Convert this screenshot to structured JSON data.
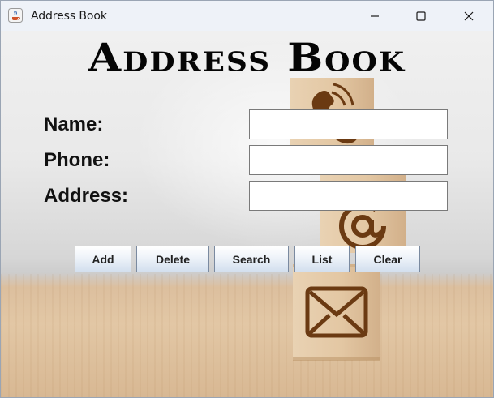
{
  "window": {
    "title": "Address Book"
  },
  "heading": "Address Book",
  "form": {
    "name_label": "Name:",
    "phone_label": "Phone:",
    "address_label": "Address:",
    "name_value": "",
    "phone_value": "",
    "address_value": ""
  },
  "buttons": {
    "add": "Add",
    "delete": "Delete",
    "search": "Search",
    "list": "List",
    "clear": "Clear"
  },
  "colors": {
    "wood": "#e3c8a6",
    "icon_brown": "#6b3a12",
    "button_border": "#7a8aa0"
  },
  "icons": [
    "java-app-icon",
    "minimize-icon",
    "maximize-icon",
    "close-icon",
    "phone-handset-icon",
    "at-sign-icon",
    "envelope-icon"
  ]
}
